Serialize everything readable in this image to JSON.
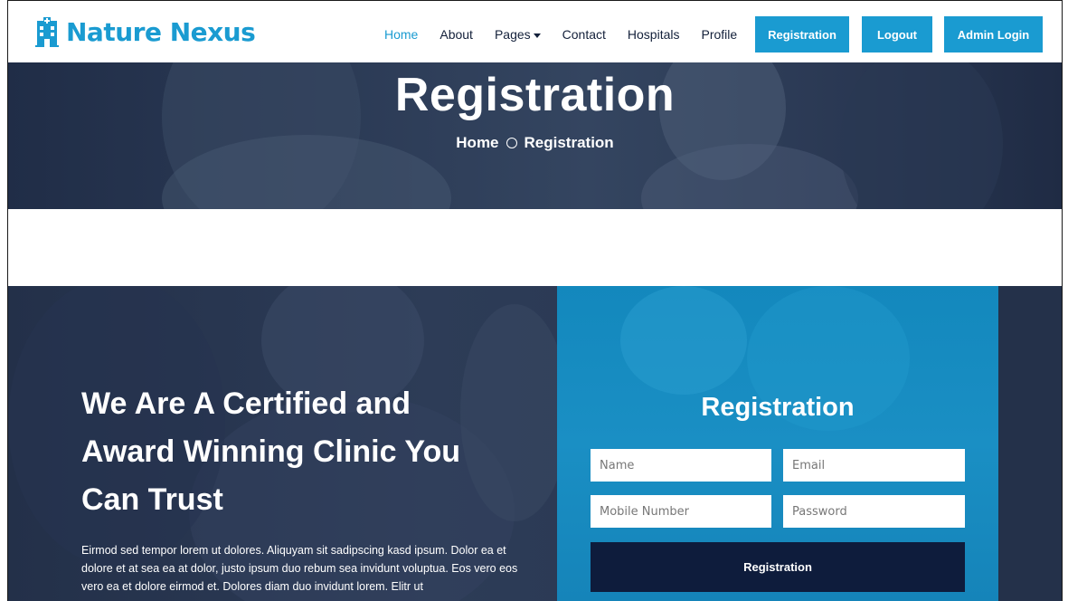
{
  "brand": {
    "name": "Nature Nexus",
    "icon": "hospital-building-icon",
    "color": "#1a9bd1"
  },
  "nav": {
    "links": [
      {
        "label": "Home",
        "active": true
      },
      {
        "label": "About"
      },
      {
        "label": "Pages",
        "dropdown": true
      },
      {
        "label": "Contact"
      },
      {
        "label": "Hospitals"
      },
      {
        "label": "Profile"
      }
    ],
    "buttons": {
      "registration": "Registration",
      "logout": "Logout",
      "admin_login": "Admin Login"
    }
  },
  "hero": {
    "title": "Registration",
    "breadcrumb": {
      "home": "Home",
      "current": "Registration"
    }
  },
  "about": {
    "headline": "We Are A Certified and Award Winning Clinic You Can Trust",
    "text": "Eirmod sed tempor lorem ut dolores. Aliquyam sit sadipscing kasd ipsum. Dolor ea et dolore et at sea ea at dolor, justo ipsum duo rebum sea invidunt voluptua. Eos vero eos vero ea et dolore eirmod et. Dolores diam duo invidunt lorem. Elitr ut"
  },
  "form": {
    "title": "Registration",
    "name_placeholder": "Name",
    "email_placeholder": "Email",
    "mobile_placeholder": "Mobile Number",
    "password_placeholder": "Password",
    "submit_label": "Registration"
  },
  "colors": {
    "accent": "#1a9bd1",
    "dark_navy": "#0e1c3c",
    "text_dark": "#13203a"
  }
}
